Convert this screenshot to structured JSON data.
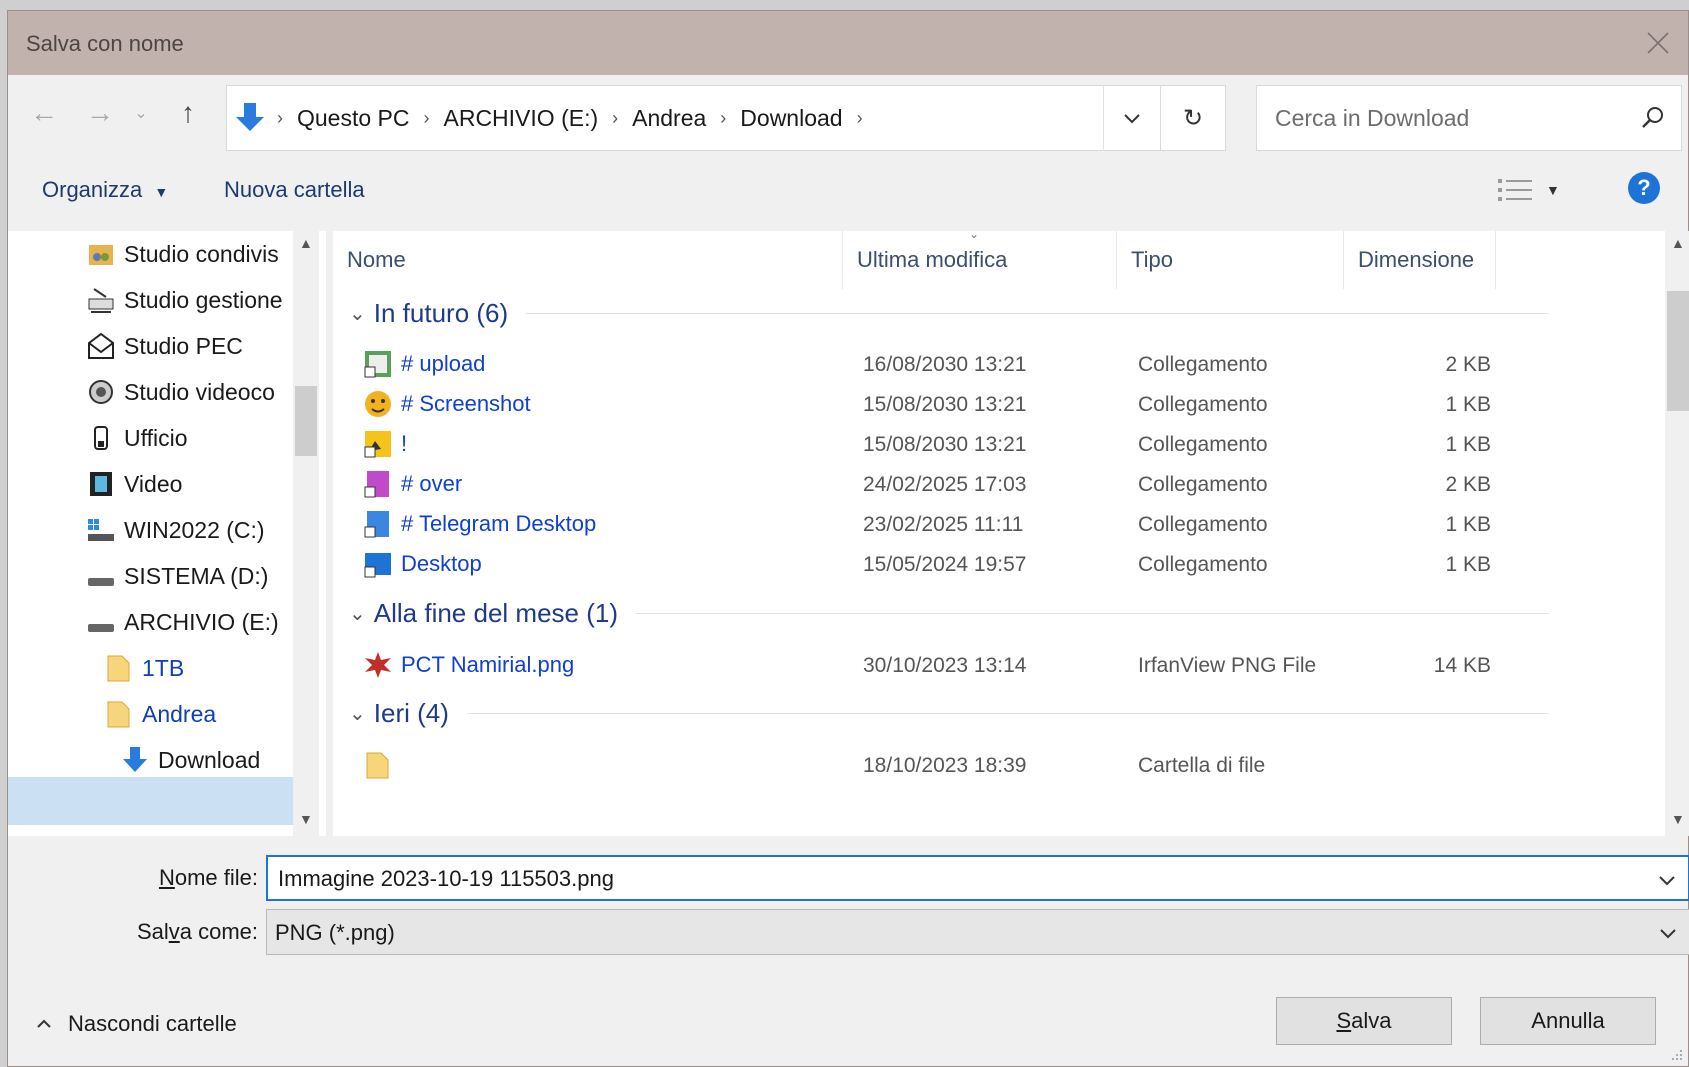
{
  "window": {
    "title": "Salva con nome"
  },
  "address": {
    "crumbs": [
      "Questo PC",
      "ARCHIVIO (E:)",
      "Andrea",
      "Download"
    ]
  },
  "search": {
    "placeholder": "Cerca in Download"
  },
  "toolbar": {
    "organize_label": "Organizza",
    "new_folder_label": "Nuova cartella"
  },
  "nav_items": [
    {
      "label": "Studio condivis",
      "icon": "shared-folder-icon"
    },
    {
      "label": "Studio gestione",
      "icon": "network-drive-icon"
    },
    {
      "label": "Studio PEC",
      "icon": "mail-icon"
    },
    {
      "label": "Studio videoco",
      "icon": "camera-icon"
    },
    {
      "label": "Ufficio",
      "icon": "usb-icon"
    },
    {
      "label": "Video",
      "icon": "film-icon"
    },
    {
      "label": "WIN2022 (C:)",
      "icon": "windows-drive-icon"
    },
    {
      "label": "SISTEMA (D:)",
      "icon": "drive-icon"
    },
    {
      "label": "ARCHIVIO (E:)",
      "icon": "drive-icon"
    },
    {
      "label": "1TB",
      "icon": "folder-icon"
    },
    {
      "label": "Andrea",
      "icon": "folder-icon"
    },
    {
      "label": "Download",
      "icon": "download-icon"
    }
  ],
  "columns": {
    "name": "Nome",
    "modified": "Ultima modifica",
    "type": "Tipo",
    "size": "Dimensione"
  },
  "groups": [
    {
      "label": "In futuro (6)",
      "files": [
        {
          "name": "# upload",
          "date": "16/08/2030 13:21",
          "type": "Collegamento",
          "size": "2 KB"
        },
        {
          "name": "# Screenshot",
          "date": "15/08/2030 13:21",
          "type": "Collegamento",
          "size": "1 KB"
        },
        {
          "name": "!",
          "date": "15/08/2030 13:21",
          "type": "Collegamento",
          "size": "1 KB"
        },
        {
          "name": "# over",
          "date": "24/02/2025 17:03",
          "type": "Collegamento",
          "size": "2 KB"
        },
        {
          "name": "# Telegram Desktop",
          "date": "23/02/2025 11:11",
          "type": "Collegamento",
          "size": "1 KB"
        },
        {
          "name": "Desktop",
          "date": "15/05/2024 19:57",
          "type": "Collegamento",
          "size": "1 KB"
        }
      ]
    },
    {
      "label": "Alla fine del mese (1)",
      "files": [
        {
          "name": "PCT Namirial.png",
          "date": "30/10/2023 13:14",
          "type": "IrfanView PNG File",
          "size": "14 KB"
        }
      ]
    },
    {
      "label": "Ieri (4)",
      "files": [
        {
          "name": "",
          "date": "18/10/2023 18:39",
          "type": "Cartella di file",
          "size": ""
        }
      ]
    }
  ],
  "form": {
    "filename_label_pre": "",
    "filename_label_u": "N",
    "filename_label_post": "ome file:",
    "filename_value": "Immagine 2023-10-19 115503.png",
    "savetype_label_pre": "Sal",
    "savetype_label_u": "v",
    "savetype_label_post": "a come:",
    "savetype_value": "PNG (*.png)"
  },
  "footer": {
    "hide_folders_label": "Nascondi cartelle",
    "save_u": "S",
    "save_rest": "alva",
    "cancel_label": "Annulla"
  },
  "colors": {
    "accent": "#1e73d6",
    "titlebar": "#c2b2ad",
    "link": "#1040d0"
  }
}
